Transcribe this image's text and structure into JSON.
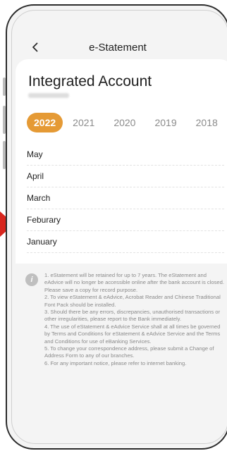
{
  "header": {
    "title": "e-Statement"
  },
  "account": {
    "title": "Integrated Account"
  },
  "years": [
    {
      "label": "2022",
      "active": true
    },
    {
      "label": "2021",
      "active": false
    },
    {
      "label": "2020",
      "active": false
    },
    {
      "label": "2019",
      "active": false
    },
    {
      "label": "2018",
      "active": false
    }
  ],
  "months": [
    "May",
    "April",
    "March",
    "Feburary",
    "January"
  ],
  "notice": {
    "lines": [
      "1. eStatement will be retained for up to 7 years. The eStatement and eAdvice will no longer be accessible online after the bank account is closed. Please save a copy for record purpose.",
      "2. To view eStatement & eAdvice, Acrobat Reader and Chinese Traditional Font Pack should be installed.",
      "3. Should there be any errors, discrepancies, unauthorised transactions or other irregularities, please report to the Bank immediately.",
      "4. The use of eStatement & eAdvice Service shall at all times be governed by Terms and Conditions for eStatement & eAdvice Service and the Terms and Conditions for use of eBanking Services.",
      "5. To change your correspondence address, please submit a Change of Address Form to any of our branches.",
      "6. For any important notice, please refer to internet banking."
    ]
  },
  "colors": {
    "accent": "#e59a35",
    "highlight_arrow": "#d7261e"
  },
  "icons": {
    "back": "chevron-left-icon",
    "info": "info-icon"
  }
}
